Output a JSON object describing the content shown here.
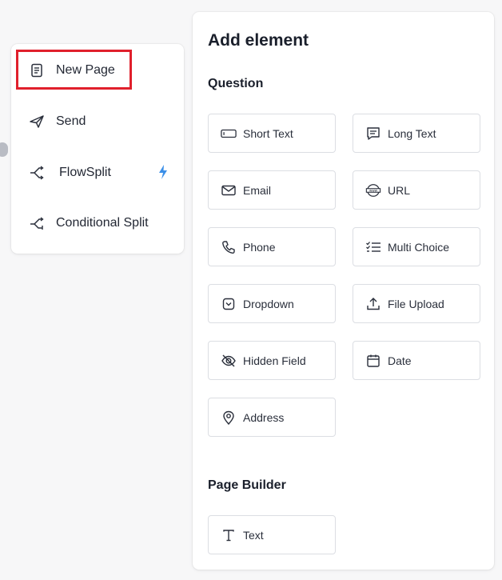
{
  "menu": {
    "items": [
      {
        "label": "New Page",
        "icon": "page-icon"
      },
      {
        "label": "Send",
        "icon": "send-icon"
      },
      {
        "label": "FlowSplit",
        "icon": "split-icon",
        "badge_icon": "bolt-icon",
        "badge_color": "#3b8fe8"
      },
      {
        "label": "Conditional Split",
        "icon": "conditional-split-icon"
      }
    ],
    "highlight_color": "#e0202c"
  },
  "panel": {
    "title": "Add element",
    "sections": [
      {
        "heading": "Question",
        "elements": [
          {
            "label": "Short Text",
            "icon": "short-text-icon"
          },
          {
            "label": "Long Text",
            "icon": "long-text-icon"
          },
          {
            "label": "Email",
            "icon": "email-icon"
          },
          {
            "label": "URL",
            "icon": "url-icon"
          },
          {
            "label": "Phone",
            "icon": "phone-icon"
          },
          {
            "label": "Multi Choice",
            "icon": "multi-choice-icon"
          },
          {
            "label": "Dropdown",
            "icon": "dropdown-icon"
          },
          {
            "label": "File Upload",
            "icon": "upload-icon"
          },
          {
            "label": "Hidden Field",
            "icon": "eye-off-icon"
          },
          {
            "label": "Date",
            "icon": "calendar-icon"
          },
          {
            "label": "Address",
            "icon": "location-pin-icon"
          }
        ]
      },
      {
        "heading": "Page Builder",
        "elements": [
          {
            "label": "Text",
            "icon": "text-icon"
          }
        ]
      }
    ]
  }
}
